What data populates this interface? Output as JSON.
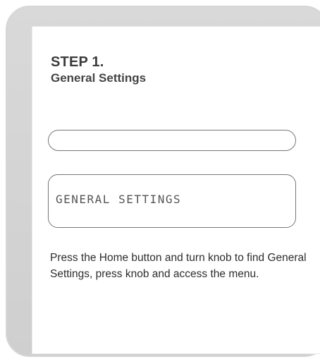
{
  "step": {
    "title": "STEP 1.",
    "subtitle": "General Settings"
  },
  "display": {
    "top_line": "",
    "main_text": "GENERAL SETTINGS"
  },
  "instructions": "Press the Home button and turn knob to find General Settings, press knob and access the menu."
}
